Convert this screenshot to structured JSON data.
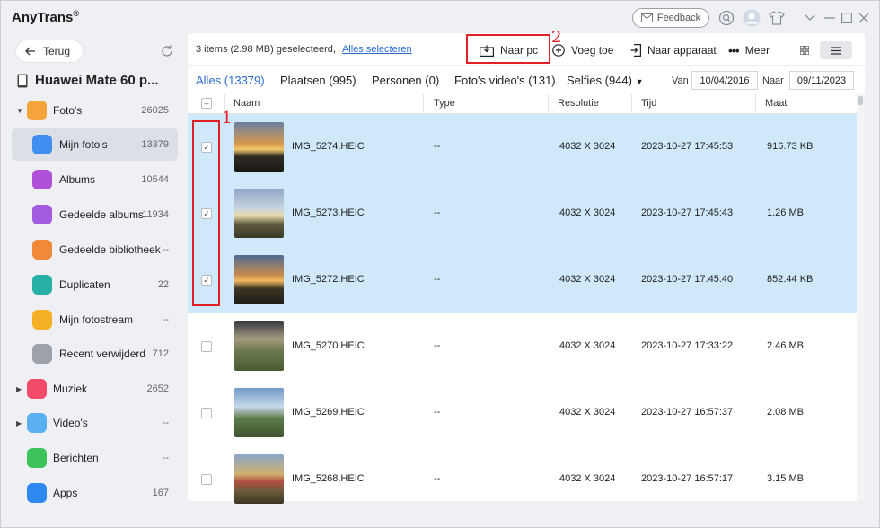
{
  "app": {
    "title": "AnyTrans",
    "title_mark": "®",
    "feedback_label": "Feedback"
  },
  "sidebar": {
    "back_label": "Terug",
    "device_name": "Huawei Mate 60 p...",
    "items": [
      {
        "label": "Foto's",
        "count": "26025",
        "icon": "photos-icon",
        "color": "#f4a43b",
        "arrow": "▼"
      },
      {
        "label": "Mijn foto's",
        "count": "13379",
        "icon": "my-photos-icon",
        "color": "#3f8ef0",
        "arrow": ""
      },
      {
        "label": "Albums",
        "count": "10544",
        "icon": "albums-icon",
        "color": "#b04fd8",
        "arrow": ""
      },
      {
        "label": "Gedeelde albums",
        "count": "11934",
        "icon": "shared-albums-icon",
        "color": "#a35be2",
        "arrow": ""
      },
      {
        "label": "Gedeelde bibliotheek",
        "count": "--",
        "icon": "shared-library-icon",
        "color": "#f08a38",
        "arrow": ""
      },
      {
        "label": "Duplicaten",
        "count": "22",
        "icon": "duplicates-icon",
        "color": "#27b0a6",
        "arrow": ""
      },
      {
        "label": "Mijn fotostream",
        "count": "--",
        "icon": "photostream-icon",
        "color": "#f5b126",
        "arrow": ""
      },
      {
        "label": "Recent verwijderd",
        "count": "712",
        "icon": "trash-icon",
        "color": "#9ca1aa",
        "arrow": ""
      },
      {
        "label": "Muziek",
        "count": "2652",
        "icon": "music-icon",
        "color": "#f24b6a",
        "arrow": "▶"
      },
      {
        "label": "Video's",
        "count": "--",
        "icon": "videos-icon",
        "color": "#5ab0f0",
        "arrow": "▶"
      },
      {
        "label": "Berichten",
        "count": "--",
        "icon": "messages-icon",
        "color": "#3cc45a",
        "arrow": ""
      },
      {
        "label": "Apps",
        "count": "167",
        "icon": "apps-icon",
        "color": "#2f88f0",
        "arrow": ""
      }
    ]
  },
  "toolbar": {
    "selection_info": "3 items (2.98 MB) geselecteerd,",
    "select_all": "Alles selecteren",
    "to_pc": "Naar pc",
    "add": "Voeg toe",
    "to_device": "Naar apparaat",
    "more": "Meer"
  },
  "filters": {
    "tabs": [
      "Alles (13379)",
      "Plaatsen (995)",
      "Personen (0)",
      "Foto's video's (131)",
      "Selfies (944)"
    ],
    "from_label": "Van",
    "from_date": "10/04/2016",
    "to_label": "Naar",
    "to_date": "09/11/2023"
  },
  "table": {
    "headers": {
      "name": "Naam",
      "type": "Type",
      "resolution": "Resolutie",
      "time": "Tijd",
      "size": "Maat"
    },
    "rows": [
      {
        "name": "IMG_5274.HEIC",
        "type": "--",
        "resolution": "4032 X 3024",
        "time": "2023-10-27 17:45:53",
        "size": "916.73 KB",
        "selected": true
      },
      {
        "name": "IMG_5273.HEIC",
        "type": "--",
        "resolution": "4032 X 3024",
        "time": "2023-10-27 17:45:43",
        "size": "1.26 MB",
        "selected": true
      },
      {
        "name": "IMG_5272.HEIC",
        "type": "--",
        "resolution": "4032 X 3024",
        "time": "2023-10-27 17:45:40",
        "size": "852.44 KB",
        "selected": true
      },
      {
        "name": "IMG_5270.HEIC",
        "type": "--",
        "resolution": "4032 X 3024",
        "time": "2023-10-27 17:33:22",
        "size": "2.46 MB",
        "selected": false
      },
      {
        "name": "IMG_5269.HEIC",
        "type": "--",
        "resolution": "4032 X 3024",
        "time": "2023-10-27 16:57:37",
        "size": "2.08 MB",
        "selected": false
      },
      {
        "name": "IMG_5268.HEIC",
        "type": "--",
        "resolution": "4032 X 3024",
        "time": "2023-10-27 16:57:17",
        "size": "3.15 MB",
        "selected": false
      }
    ]
  },
  "annotations": {
    "one": "1",
    "two": "2"
  },
  "colors": {
    "accent": "#2b6cd3",
    "selection": "#cfe9fb",
    "highlight": "#e01f26"
  }
}
